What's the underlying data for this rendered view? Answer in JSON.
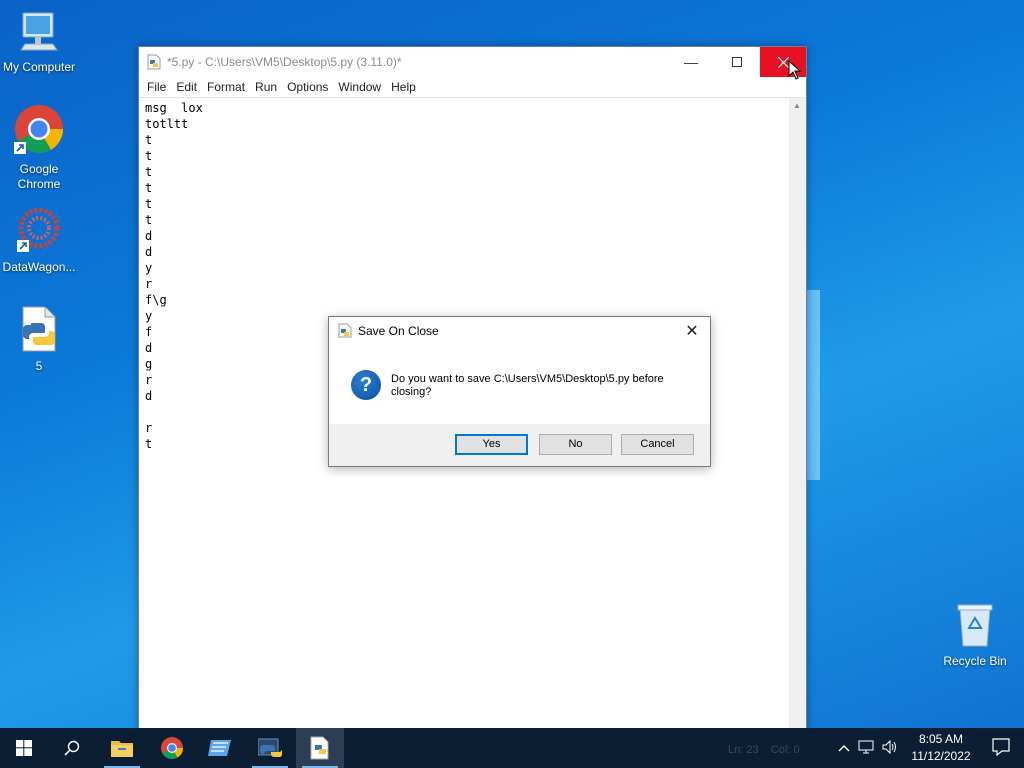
{
  "desktop": {
    "icons": [
      {
        "label": "My Computer"
      },
      {
        "label": "Google Chrome"
      },
      {
        "label": "DataWagon..."
      },
      {
        "label": "5"
      },
      {
        "label": "Recycle Bin"
      }
    ]
  },
  "window": {
    "title": "*5.py - C:\\Users\\VM5\\Desktop\\5.py (3.11.0)*",
    "menu": [
      "File",
      "Edit",
      "Format",
      "Run",
      "Options",
      "Window",
      "Help"
    ],
    "lines": [
      "msg  lox",
      "totltt",
      "t",
      "t",
      "t",
      "t",
      "t",
      "t",
      "d",
      "d",
      "y",
      "r",
      "f\\g",
      "y",
      "f",
      "d",
      "g",
      "r",
      "d",
      "",
      "r",
      "t"
    ],
    "status": {
      "ln": "Ln: 23",
      "col": "Col: 0"
    }
  },
  "dialog": {
    "title": "Save On Close",
    "message": "Do you want to save C:\\Users\\VM5\\Desktop\\5.py before closing?",
    "buttons": {
      "yes": "Yes",
      "no": "No",
      "cancel": "Cancel"
    }
  },
  "taskbar": {
    "clock_time": "8:05 AM",
    "clock_date": "11/12/2022"
  },
  "colors": {
    "close_red": "#e81123",
    "accent": "#0078d7",
    "taskbar": "#0b1e33"
  }
}
